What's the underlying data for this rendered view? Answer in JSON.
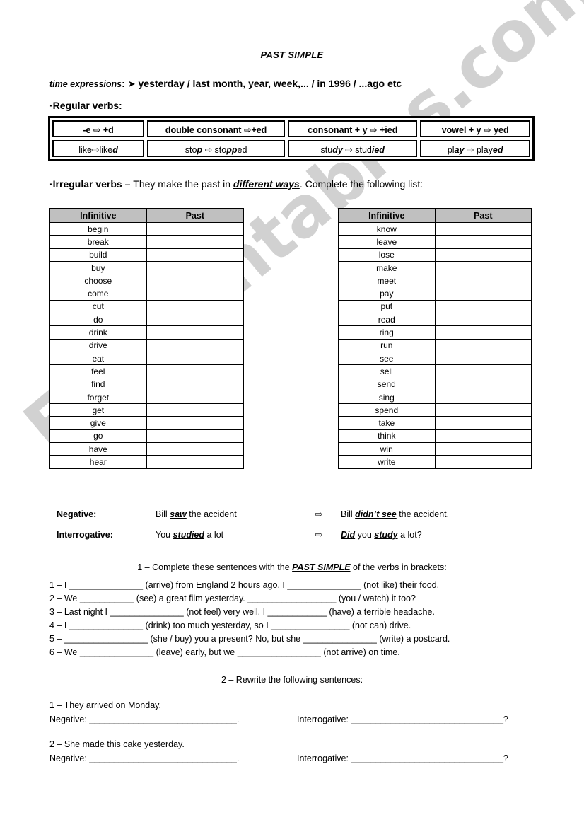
{
  "watermark": {
    "text": "ESLprintables.com"
  },
  "header": {
    "title": "PAST SIMPLE",
    "time_expressions_label": "time expressions",
    "time_expressions_colon": ":",
    "time_expressions_arrow": "➤",
    "time_expressions_value": "yesterday / last month, year, week,... / in 1996 / ...ago etc",
    "regular_verbs_label": "·Regular verbs:"
  },
  "regular_verbs": {
    "rules": [
      {
        "pre": "-e ",
        "arrow": "⇨",
        "post_plain": " +",
        "post_underline": "d"
      },
      {
        "pre": "double consonant ",
        "arrow": "⇨",
        "post_plain": "+",
        "post_underline": "ed"
      },
      {
        "pre": "consonant + y ",
        "arrow": "⇨",
        "post_plain": " +",
        "post_underline": "ied"
      },
      {
        "pre": "vowel + y ",
        "arrow": "⇨",
        "post_plain": " ",
        "post_underline": "yed"
      }
    ],
    "examples": [
      {
        "base_plain": "lik",
        "base_underline": "e",
        "arrow": "⇨",
        "past_plain": "like",
        "past_underline": "d"
      },
      {
        "base_plain": "sto",
        "base_underline": "p",
        "arrow": "⇨",
        "past_plain": "sto",
        "past_underline": "pp",
        "past_tail": "ed"
      },
      {
        "base_plain": "stu",
        "base_underline": "dy",
        "arrow": "⇨",
        "past_plain": "stud",
        "past_underline": "ied"
      },
      {
        "base_plain": "pl",
        "base_underline": "ay",
        "arrow": "⇨",
        "past_plain": "play",
        "past_underline": "ed"
      }
    ]
  },
  "irregular": {
    "label": "·Irregular verbs – ",
    "text_before": "They make the past in ",
    "emphasis": "different ways",
    "text_after": ". Complete the following list:",
    "columns": [
      "Infinitive",
      "Past"
    ],
    "left_verbs": [
      "begin",
      "break",
      "build",
      "buy",
      "choose",
      "come",
      "cut",
      "do",
      "drink",
      "drive",
      "eat",
      "feel",
      "find",
      "forget",
      "get",
      "give",
      "go",
      "have",
      "hear"
    ],
    "right_verbs": [
      "know",
      "leave",
      "lose",
      "make",
      "meet",
      "pay",
      "put",
      "read",
      "ring",
      "run",
      "see",
      "sell",
      "send",
      "sing",
      "spend",
      "take",
      "think",
      "win",
      "write"
    ],
    "left_past": [
      "",
      "",
      "",
      "",
      "",
      "",
      "",
      "",
      "",
      "",
      "",
      "",
      "",
      "",
      "",
      "",
      "",
      "",
      ""
    ],
    "right_past": [
      "",
      "",
      "",
      "",
      "",
      "",
      "",
      "",
      "",
      "",
      "",
      "",
      "",
      "",
      "",
      "",
      "",
      "",
      ""
    ]
  },
  "examples_section": {
    "arrow": "⇨",
    "rows": [
      {
        "label": "Negative:",
        "left_pre": "Bill ",
        "left_em": "saw",
        "left_post": " the accident",
        "right_pre": "Bill ",
        "right_em": "didn’t see",
        "right_post": " the accident."
      },
      {
        "label": "Interrogative:",
        "left_pre": "You ",
        "left_em": "studied",
        "left_post": " a lot",
        "right_pre": "",
        "right_em": "Did",
        "right_mid": " you ",
        "right_em2": "study",
        "right_post": " a lot?"
      }
    ]
  },
  "exercise1": {
    "heading_before": "1 – Complete these sentences with the ",
    "heading_emphasis": "PAST SIMPLE",
    "heading_after": " of the verbs in brackets:",
    "questions": [
      "1 – I _______________ (arrive) from England 2 hours ago. I _______________ (not like) their food.",
      "2 – We ___________ (see) a great film yesterday. __________________ (you / watch) it too?",
      "3 – Last night I _______________ (not feel) very well. I ____________ (have) a terrible headache.",
      "4 – I _______________ (drink) too much yesterday, so I ________________ (not can) drive.",
      "5 – _________________ (she / buy) you a present? No, but she _______________ (write) a postcard.",
      "6 – We _______________ (leave) early, but we _________________ (not arrive) on time."
    ]
  },
  "exercise2": {
    "heading": "2 – Rewrite the following sentences:",
    "negative_label": "Negative: ",
    "interrogative_label": "Interrogative: ",
    "negative_blank": "______________________________.",
    "interrogative_blank": "_______________________________?",
    "items": [
      {
        "stem": "1 – They arrived on Monday."
      },
      {
        "stem": "2 – She made this cake yesterday."
      }
    ]
  }
}
